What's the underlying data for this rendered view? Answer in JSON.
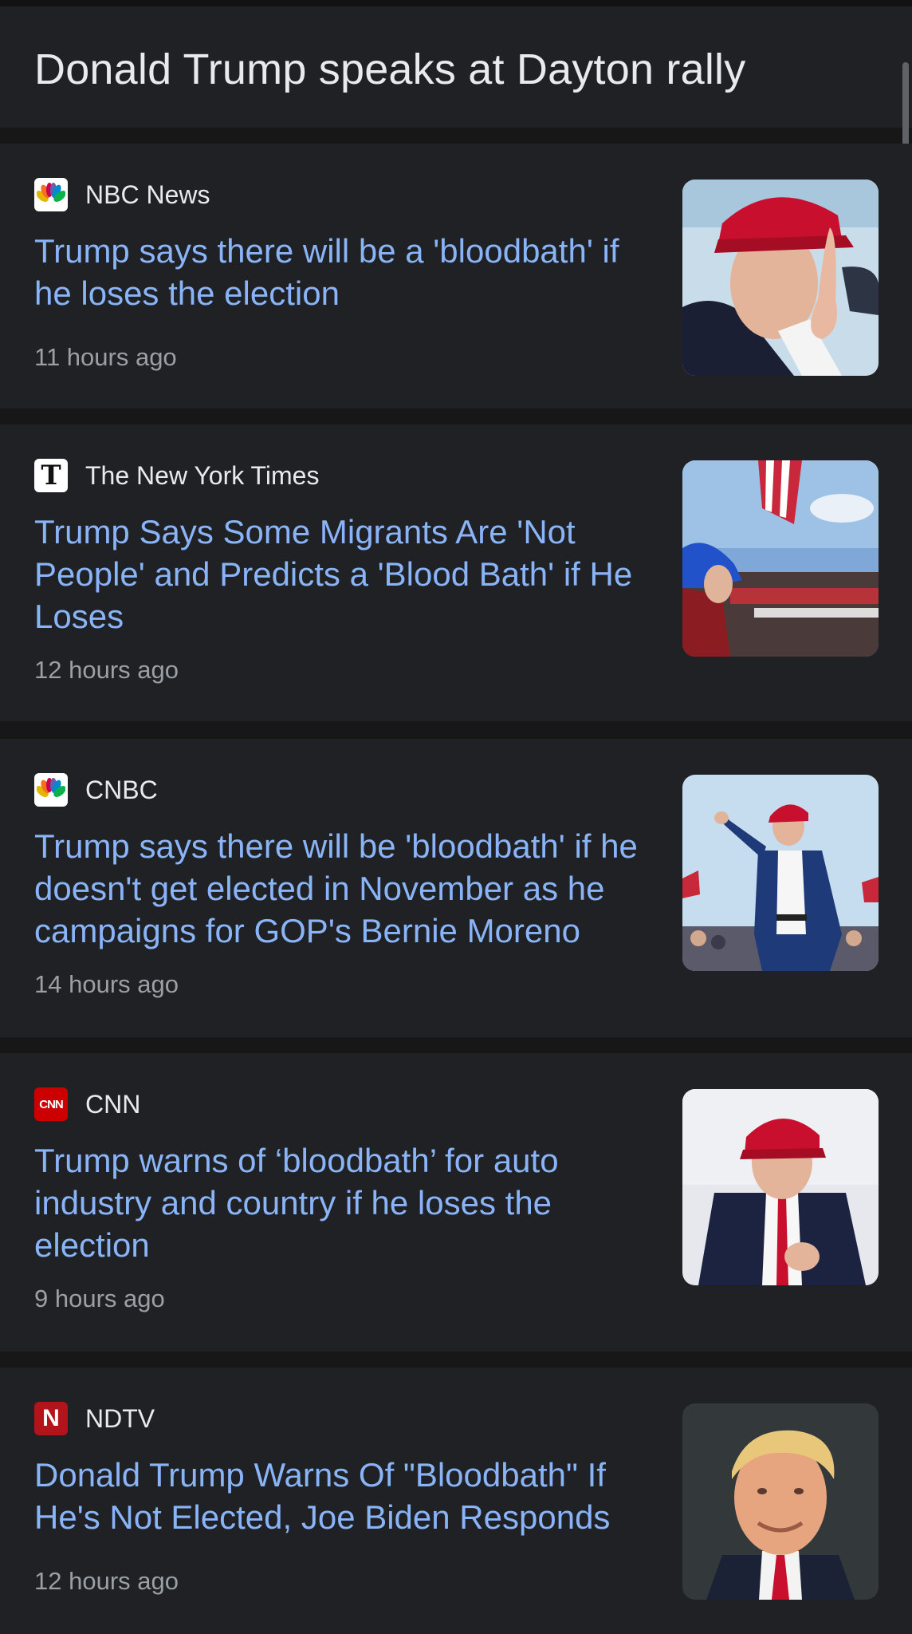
{
  "header": {
    "title": "Donald Trump speaks at Dayton rally"
  },
  "articles": [
    {
      "source": "NBC News",
      "headline": "Trump says there will be a 'bloodbath' if he loses the election",
      "time": "11 hours ago",
      "logo_icon": "nbc-peacock-icon"
    },
    {
      "source": "The New York Times",
      "headline": "Trump Says Some Migrants Are 'Not People' and Predicts a 'Blood Bath' if He Loses",
      "time": "12 hours ago",
      "logo_icon": "nyt-t-icon"
    },
    {
      "source": "CNBC",
      "headline": "Trump says there will be 'bloodbath' if he doesn't get elected in November as he campaigns for GOP's Bernie Moreno",
      "time": "14 hours ago",
      "logo_icon": "cnbc-peacock-icon"
    },
    {
      "source": "CNN",
      "headline": "Trump warns of ‘bloodbath’ for auto industry and country if he loses the election",
      "time": "9 hours ago",
      "logo_icon": "cnn-icon",
      "logo_text": "CNN"
    },
    {
      "source": "NDTV",
      "headline": "Donald Trump Warns Of \"Bloodbath\" If He's Not Elected, Joe Biden Responds",
      "time": "12 hours ago",
      "logo_icon": "ndtv-icon",
      "logo_text": "N"
    }
  ],
  "colors": {
    "background": "#171717",
    "card": "#202124",
    "headline": "#8ab4f8",
    "source": "#e8eaed",
    "time": "#9aa0a6"
  }
}
